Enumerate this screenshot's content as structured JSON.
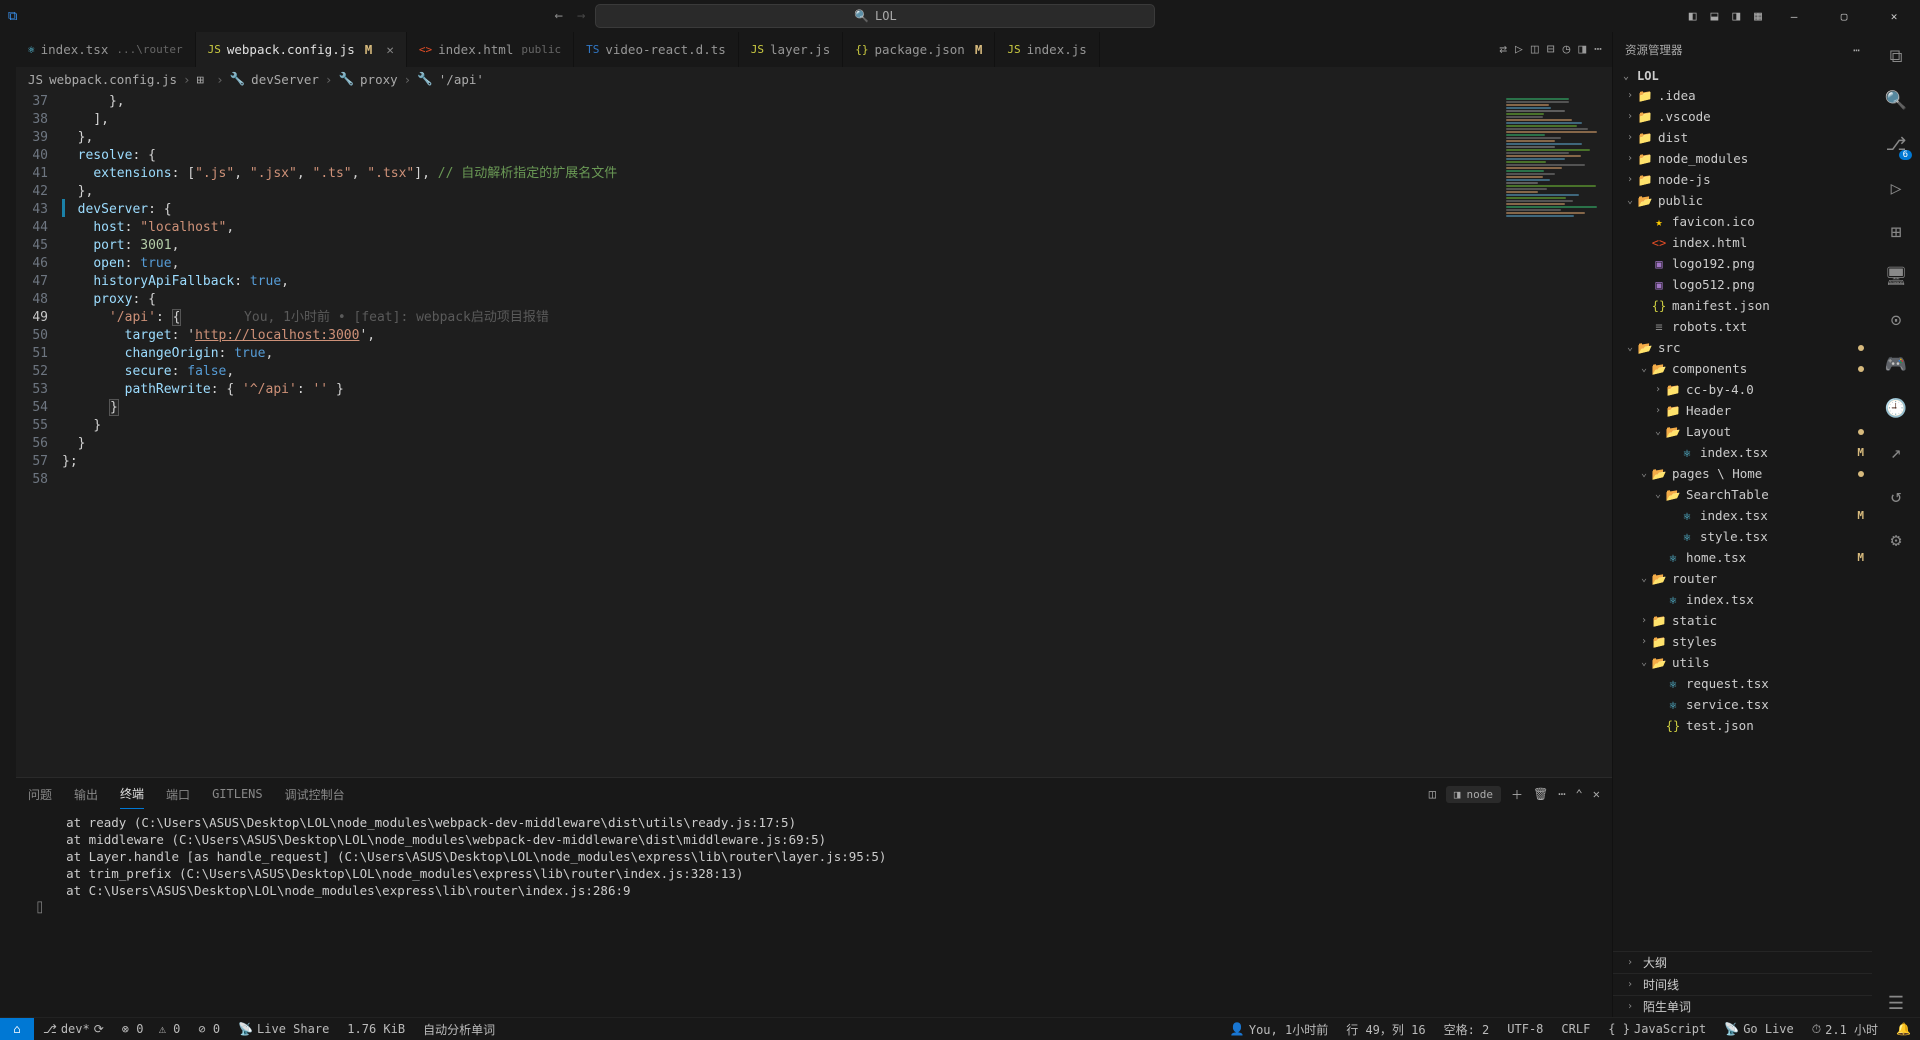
{
  "title_search": "LOL",
  "tabs": [
    {
      "icon": "⚛",
      "iconCls": "ic-react",
      "name": "index.tsx",
      "desc": "...\\router",
      "mod": "",
      "active": false
    },
    {
      "icon": "JS",
      "iconCls": "ic-js",
      "name": "webpack.config.js",
      "desc": "",
      "mod": "M",
      "active": true,
      "close": true
    },
    {
      "icon": "<>",
      "iconCls": "ic-html",
      "name": "index.html",
      "desc": "public",
      "mod": "",
      "active": false
    },
    {
      "icon": "TS",
      "iconCls": "ic-ts",
      "name": "video-react.d.ts",
      "desc": "",
      "mod": "",
      "active": false
    },
    {
      "icon": "JS",
      "iconCls": "ic-js",
      "name": "layer.js",
      "desc": "",
      "mod": "",
      "active": false
    },
    {
      "icon": "{}",
      "iconCls": "ic-json",
      "name": "package.json",
      "desc": "",
      "mod": "M",
      "active": false
    },
    {
      "icon": "JS",
      "iconCls": "ic-js",
      "name": "index.js",
      "desc": "",
      "mod": "",
      "active": false
    }
  ],
  "breadcrumb": [
    {
      "icon": "JS",
      "label": "webpack.config.js"
    },
    {
      "icon": "⊞",
      "label": "<unknown>"
    },
    {
      "icon": "🔧",
      "label": "devServer"
    },
    {
      "icon": "🔧",
      "label": "proxy"
    },
    {
      "icon": "🔧",
      "label": "'/api'"
    }
  ],
  "lines": {
    "start": 37,
    "end": 58,
    "highlight": 49
  },
  "blame": "You, 1小时前 • [feat]: webpack启动项目报错",
  "code_comment": "// 自动解析指定的扩展名文件",
  "url": "http://localhost:3000",
  "panel": {
    "tabs": [
      "问题",
      "输出",
      "终端",
      "端口",
      "GITLENS",
      "调试控制台"
    ],
    "active": "终端",
    "term_label": "node",
    "lines": [
      "at ready (C:\\Users\\ASUS\\Desktop\\LOL\\node_modules\\webpack-dev-middleware\\dist\\utils\\ready.js:17:5)",
      "at middleware (C:\\Users\\ASUS\\Desktop\\LOL\\node_modules\\webpack-dev-middleware\\dist\\middleware.js:69:5)",
      "at Layer.handle [as handle_request] (C:\\Users\\ASUS\\Desktop\\LOL\\node_modules\\express\\lib\\router\\layer.js:95:5)",
      "at trim_prefix (C:\\Users\\ASUS\\Desktop\\LOL\\node_modules\\express\\lib\\router\\index.js:328:13)",
      "at C:\\Users\\ASUS\\Desktop\\LOL\\node_modules\\express\\lib\\router\\index.js:286:9"
    ]
  },
  "explorer": {
    "title": "资源管理器",
    "root": "LOL",
    "outline": "大纲",
    "timeline": "时间线",
    "unfamiliar": "陌生单词"
  },
  "tree": [
    {
      "d": 0,
      "t": "f",
      "c": ">",
      "i": "📁",
      "cls": "ic-folder",
      "n": ".idea"
    },
    {
      "d": 0,
      "t": "f",
      "c": ">",
      "i": "📁",
      "cls": "ic-folder",
      "n": ".vscode"
    },
    {
      "d": 0,
      "t": "f",
      "c": ">",
      "i": "📁",
      "cls": "ic-folder",
      "n": "dist"
    },
    {
      "d": 0,
      "t": "f",
      "c": ">",
      "i": "📁",
      "cls": "ic-folder",
      "n": "node_modules"
    },
    {
      "d": 0,
      "t": "f",
      "c": ">",
      "i": "📁",
      "cls": "ic-folder",
      "n": "node-js"
    },
    {
      "d": 0,
      "t": "f",
      "c": "v",
      "i": "📂",
      "cls": "ic-folder-open",
      "n": "public"
    },
    {
      "d": 1,
      "t": "x",
      "i": "★",
      "cls": "ic-star",
      "n": "favicon.ico"
    },
    {
      "d": 1,
      "t": "x",
      "i": "<>",
      "cls": "ic-html",
      "n": "index.html"
    },
    {
      "d": 1,
      "t": "x",
      "i": "▣",
      "cls": "ic-img",
      "n": "logo192.png"
    },
    {
      "d": 1,
      "t": "x",
      "i": "▣",
      "cls": "ic-img",
      "n": "logo512.png"
    },
    {
      "d": 1,
      "t": "x",
      "i": "{}",
      "cls": "ic-json",
      "n": "manifest.json"
    },
    {
      "d": 1,
      "t": "x",
      "i": "≡",
      "cls": "ic-txt",
      "n": "robots.txt"
    },
    {
      "d": 0,
      "t": "f",
      "c": "v",
      "i": "📂",
      "cls": "ic-green",
      "n": "src",
      "dot": true
    },
    {
      "d": 1,
      "t": "f",
      "c": "v",
      "i": "📂",
      "cls": "ic-green",
      "n": "components",
      "dot": true
    },
    {
      "d": 2,
      "t": "f",
      "c": ">",
      "i": "📁",
      "cls": "ic-folder",
      "n": "cc-by-4.0"
    },
    {
      "d": 2,
      "t": "f",
      "c": ">",
      "i": "📁",
      "cls": "ic-folder",
      "n": "Header"
    },
    {
      "d": 2,
      "t": "f",
      "c": "v",
      "i": "📂",
      "cls": "ic-green",
      "n": "Layout",
      "dot": true
    },
    {
      "d": 3,
      "t": "x",
      "i": "⚛",
      "cls": "ic-react",
      "n": "index.tsx",
      "m": "M"
    },
    {
      "d": 1,
      "t": "f",
      "c": "v",
      "i": "📂",
      "cls": "ic-green",
      "n": "pages \\ Home",
      "dot": true
    },
    {
      "d": 2,
      "t": "f",
      "c": "v",
      "i": "📂",
      "cls": "ic-folder-open",
      "n": "SearchTable"
    },
    {
      "d": 3,
      "t": "x",
      "i": "⚛",
      "cls": "ic-react",
      "n": "index.tsx",
      "m": "M"
    },
    {
      "d": 3,
      "t": "x",
      "i": "⚛",
      "cls": "ic-react",
      "n": "style.tsx"
    },
    {
      "d": 2,
      "t": "x",
      "i": "⚛",
      "cls": "ic-react",
      "n": "home.tsx",
      "m": "M"
    },
    {
      "d": 1,
      "t": "f",
      "c": "v",
      "i": "📂",
      "cls": "ic-folder-open",
      "n": "router"
    },
    {
      "d": 2,
      "t": "x",
      "i": "⚛",
      "cls": "ic-react",
      "n": "index.tsx"
    },
    {
      "d": 1,
      "t": "f",
      "c": ">",
      "i": "📁",
      "cls": "ic-folder",
      "n": "static"
    },
    {
      "d": 1,
      "t": "f",
      "c": ">",
      "i": "📁",
      "cls": "ic-folder",
      "n": "styles"
    },
    {
      "d": 1,
      "t": "f",
      "c": "v",
      "i": "📂",
      "cls": "ic-folder-open",
      "n": "utils"
    },
    {
      "d": 2,
      "t": "x",
      "i": "⚛",
      "cls": "ic-react",
      "n": "request.tsx"
    },
    {
      "d": 2,
      "t": "x",
      "i": "⚛",
      "cls": "ic-react",
      "n": "service.tsx"
    },
    {
      "d": 2,
      "t": "x",
      "i": "{}",
      "cls": "ic-json",
      "n": "test.json"
    }
  ],
  "status": {
    "branch": "dev*",
    "sync": "⟳",
    "errors": "⊗ 0",
    "warnings": "⚠ 0",
    "ports": "⊘ 0",
    "live": "Live Share",
    "size": "1.76 KiB",
    "auto": "自动分析单词",
    "blame": "You, 1小时前",
    "pos": "行 49，列 16",
    "spaces": "空格: 2",
    "enc": "UTF-8",
    "eol": "CRLF",
    "lang": "JavaScript",
    "golive": "Go Live",
    "time": "2.1 小时"
  }
}
